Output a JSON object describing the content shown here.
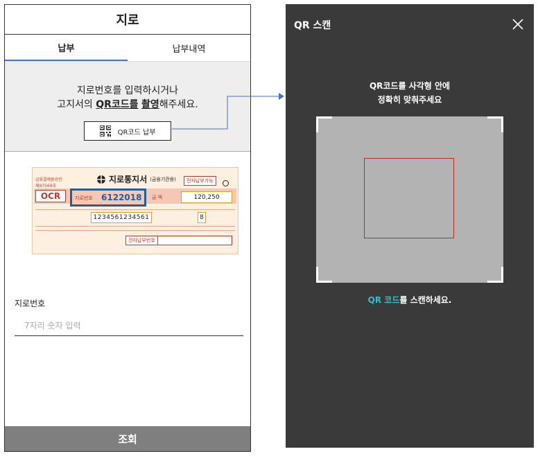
{
  "phone": {
    "title": "지로",
    "tabs": [
      "납부",
      "납부내역"
    ],
    "guide": {
      "line1": "지로번호를 입력하시거나",
      "line2_prefix": "고지서의 ",
      "line2_qr": "QR코드를",
      "line2_space": " ",
      "line2_shoot": "촬영",
      "line2_suffix": "해주세요.",
      "qr_button": "QR코드 납부"
    },
    "slip": {
      "corner_top": "금융결제원승인",
      "corner_no": "제97569호",
      "title": "지로통지서",
      "title_sub": "(금융기관용)",
      "epay_badge": "전자납부가능",
      "ocr": "OCR",
      "giro_label": "지로번호",
      "giro_number": "6122018",
      "amount_label": "금 액",
      "amount": "120,250",
      "code": "1234561234561",
      "check_digit": "8",
      "epay_label": "전자납부번호"
    },
    "field_label": "지로번호",
    "field_placeholder": "7자리 숫자 입력",
    "submit": "조회"
  },
  "scanner": {
    "title": "QR 스캔",
    "instruction_line1": "QR코드를 사각형 안에",
    "instruction_line2": "정확히 맞춰주세요",
    "hint_accent": "QR 코드",
    "hint_rest": "를 스캔하세요."
  },
  "colors": {
    "tab_underline": "#4472c4",
    "giro_highlight": "#1f5fa0",
    "scanner_bg": "#3a3a3a",
    "target_frame": "#cc2222",
    "hint_accent": "#2cc3d0",
    "submit_bg": "#7f7f7f"
  },
  "icons": [
    "qr-code-icon",
    "close-icon",
    "connector-arrow"
  ]
}
